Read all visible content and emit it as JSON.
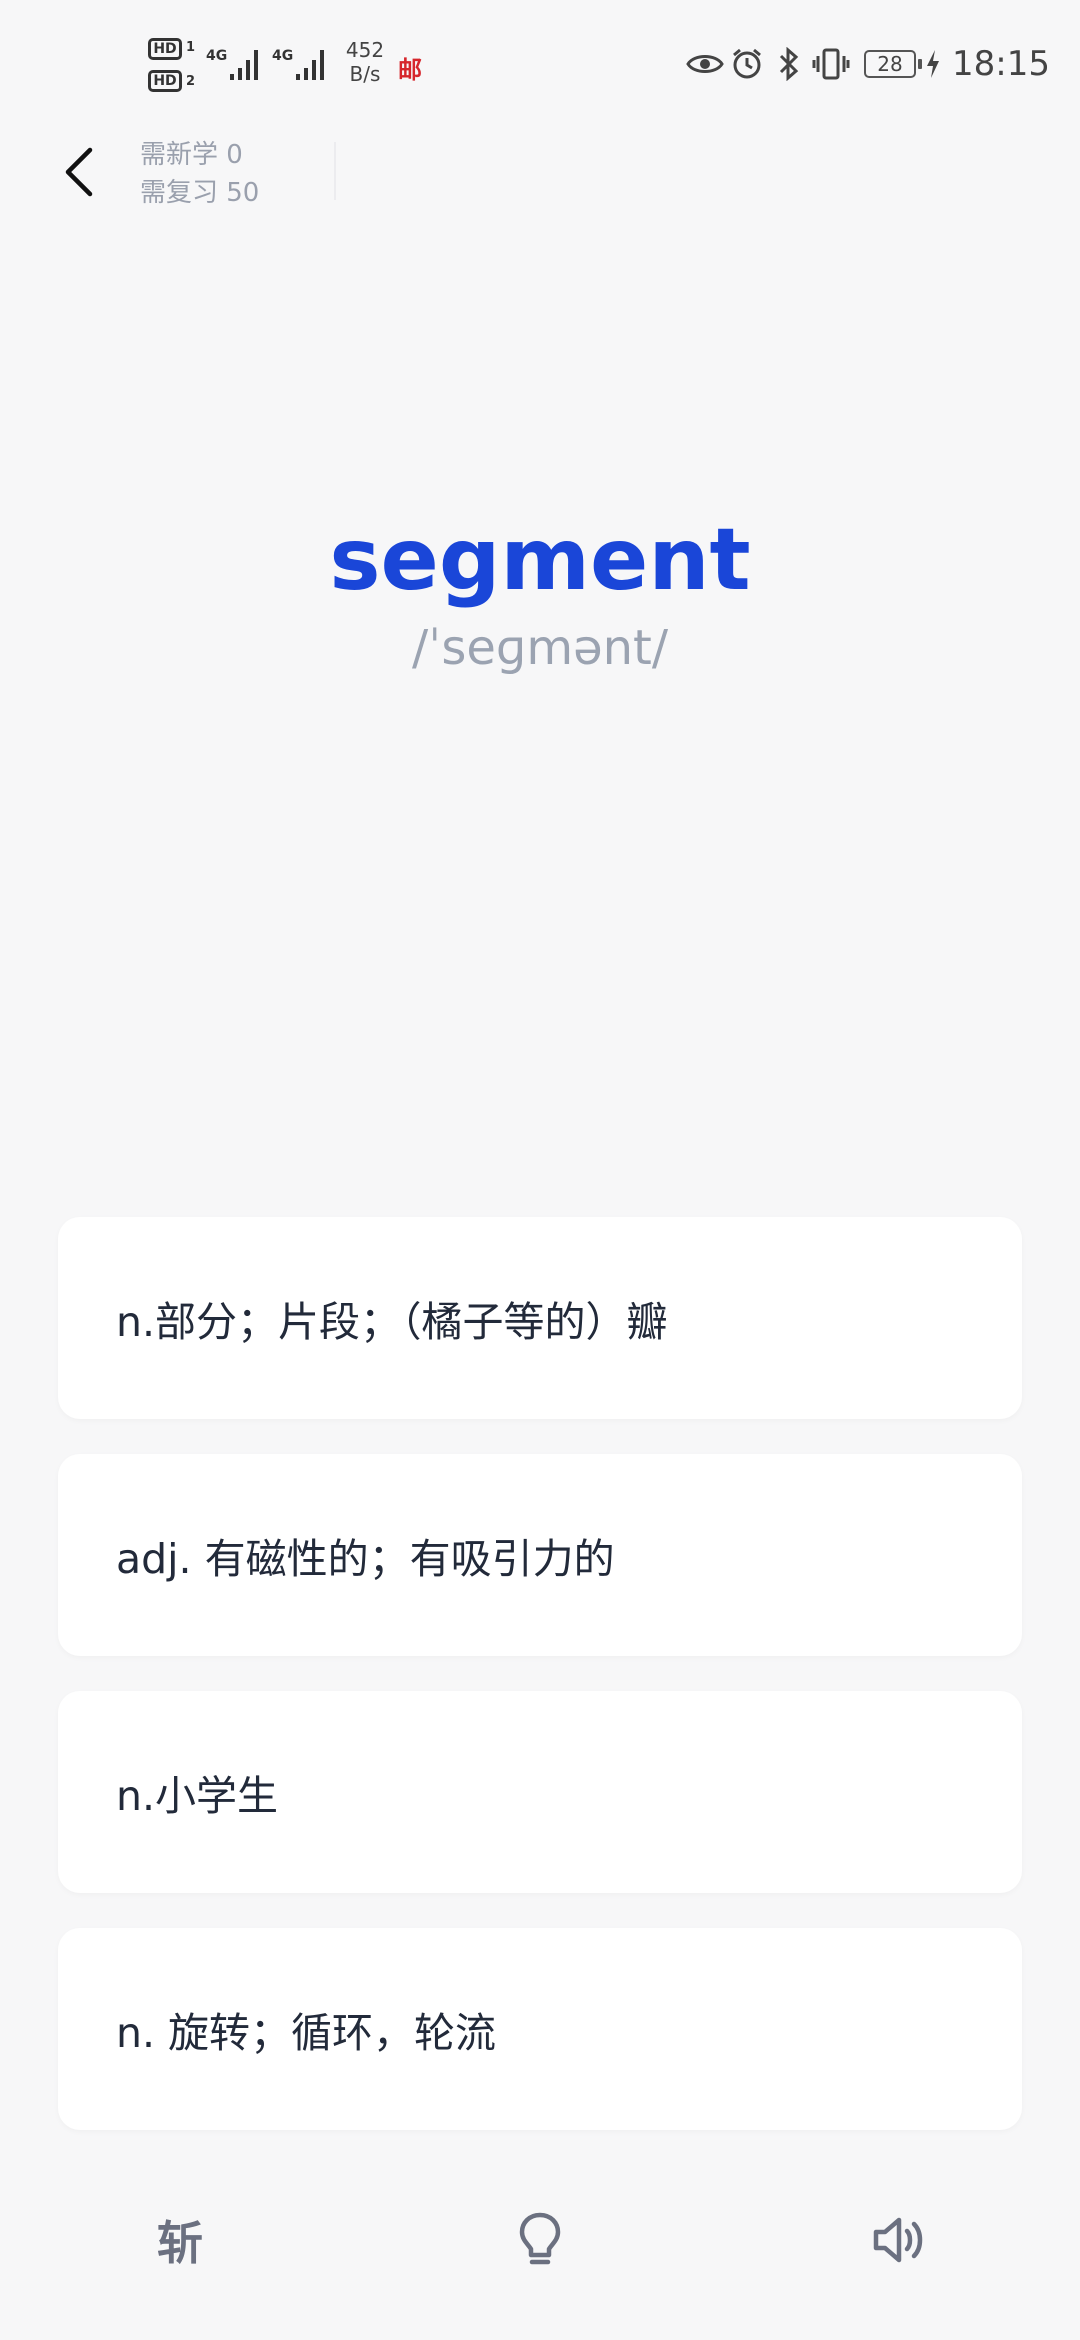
{
  "status_bar": {
    "hd1": "HD",
    "hd1_num": "1",
    "hd2": "HD",
    "hd2_num": "2",
    "sig1_tag": "4G",
    "sig2_tag": "4G",
    "speed_value": "452",
    "speed_unit": "B/s",
    "mail_icon_text": "邮",
    "battery": "28",
    "time": "18:15",
    "icons": [
      "eye-icon",
      "alarm-icon",
      "bluetooth-icon",
      "vibrate-icon",
      "battery-icon",
      "charging-icon"
    ]
  },
  "header": {
    "new_count_label": "需新学 0",
    "review_count_label": "需复习 50"
  },
  "word": {
    "text": "segment",
    "phonetic": "/ˈseɡmənt/"
  },
  "options": [
    {
      "text": "n.部分；片段；（橘子等的）瓣"
    },
    {
      "text": "adj. 有磁性的；有吸引力的"
    },
    {
      "text": "n.小学生"
    },
    {
      "text": "n. 旋转；循环，轮流"
    }
  ],
  "bottom_bar": {
    "zhan_label": "斩",
    "icons": [
      "hint-bulb-icon",
      "speaker-icon"
    ]
  },
  "colors": {
    "accent": "#1a46d8",
    "background": "#f7f7f8",
    "card": "#ffffff",
    "muted": "#9aa0ad",
    "mail_red": "#d6262c"
  }
}
